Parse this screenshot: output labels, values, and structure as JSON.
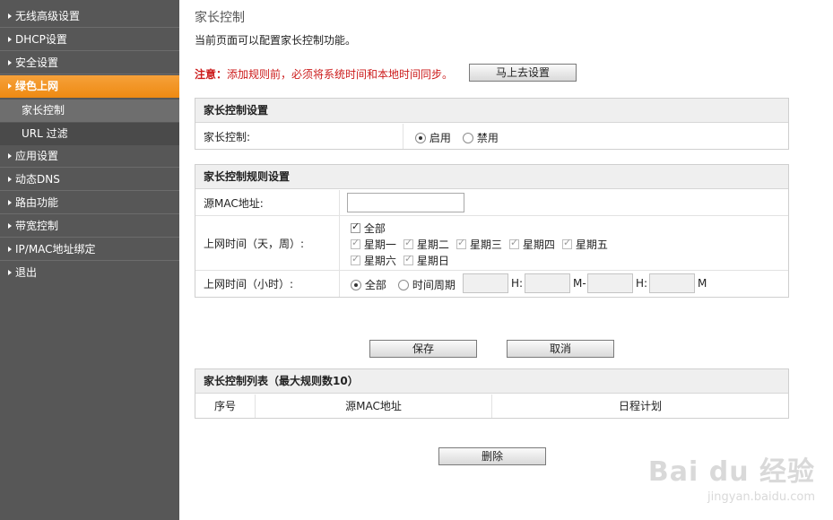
{
  "sidebar": {
    "items": [
      {
        "label": "无线高级设置"
      },
      {
        "label": "DHCP设置"
      },
      {
        "label": "安全设置"
      },
      {
        "label": "绿色上网"
      },
      {
        "label": "家长控制"
      },
      {
        "label": "URL 过滤"
      },
      {
        "label": "应用设置"
      },
      {
        "label": "动态DNS"
      },
      {
        "label": "路由功能"
      },
      {
        "label": "带宽控制"
      },
      {
        "label": "IP/MAC地址绑定"
      },
      {
        "label": "退出"
      }
    ]
  },
  "page": {
    "title": "家长控制",
    "description": "当前页面可以配置家长控制功能。",
    "notice_label": "注意：",
    "notice_text": "添加规则前，必须将系统时间和本地时间同步。",
    "sync_button": "马上去设置"
  },
  "settings": {
    "header": "家长控制设置",
    "label": "家长控制:",
    "enable": "启用",
    "disable": "禁用"
  },
  "rules": {
    "header": "家长控制规则设置",
    "mac_label": "源MAC地址:",
    "mac_value": "",
    "days_label": "上网时间（天，周）:",
    "all_days": "全部",
    "days": [
      "星期一",
      "星期二",
      "星期三",
      "星期四",
      "星期五",
      "星期六",
      "星期日"
    ],
    "hours_label": "上网时间（小时）:",
    "all_hours": "全部",
    "period": "时间周期",
    "h1": "H:",
    "m1": "M-",
    "h2": "H:",
    "m2": "M"
  },
  "actions": {
    "save": "保存",
    "cancel": "取消",
    "delete": "删除"
  },
  "list": {
    "header": "家长控制列表（最大规则数10）",
    "columns": [
      "序号",
      "源MAC地址",
      "日程计划"
    ]
  },
  "watermark": {
    "brand": "Bai du 经验",
    "url": "jingyan.baidu.com"
  }
}
